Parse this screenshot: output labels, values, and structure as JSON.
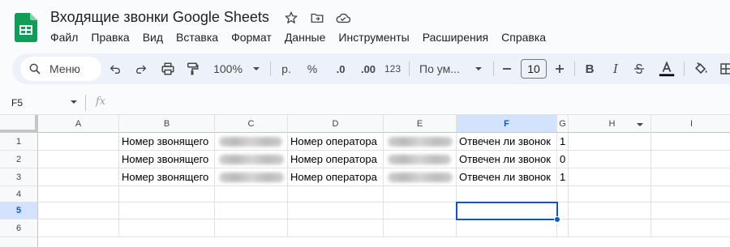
{
  "doc": {
    "title": "Входящие звонки Google Sheets"
  },
  "menu": [
    "Файл",
    "Правка",
    "Вид",
    "Вставка",
    "Формат",
    "Данные",
    "Инструменты",
    "Расширения",
    "Справка"
  ],
  "toolbar": {
    "search_label": "Меню",
    "zoom": "100%",
    "currency": "р.",
    "percent": "%",
    "dec_decrease": ".0",
    "dec_increase": ".00",
    "number_format": "123",
    "font": "По ум...",
    "font_size": "10",
    "text_color": "#000000"
  },
  "formula_bar": {
    "name_box": "F5",
    "fx_label": "fx"
  },
  "grid": {
    "columns": [
      "A",
      "B",
      "C",
      "D",
      "E",
      "F",
      "G",
      "H",
      "I"
    ],
    "selected_column": "F",
    "rows": [
      "1",
      "2",
      "3",
      "4",
      "5",
      "6"
    ],
    "selected_row": "5",
    "cells": {
      "r1": {
        "B": "Номер звонящего",
        "D": "Номер оператора",
        "F": "Отвечен ли звонок",
        "G": "1"
      },
      "r2": {
        "B": "Номер звонящего",
        "D": "Номер оператора",
        "F": "Отвечен ли звонок",
        "G": "0"
      },
      "r3": {
        "B": "Номер звонящего",
        "D": "Номер оператора",
        "F": "Отвечен ли звонок",
        "G": "1"
      }
    },
    "active_cell": "F5"
  },
  "colors": {
    "accent": "#0b57d0",
    "selection_header": "#d3e3fd",
    "toolbar_bg": "#edf2fa",
    "sheets_green": "#0f9d58"
  }
}
